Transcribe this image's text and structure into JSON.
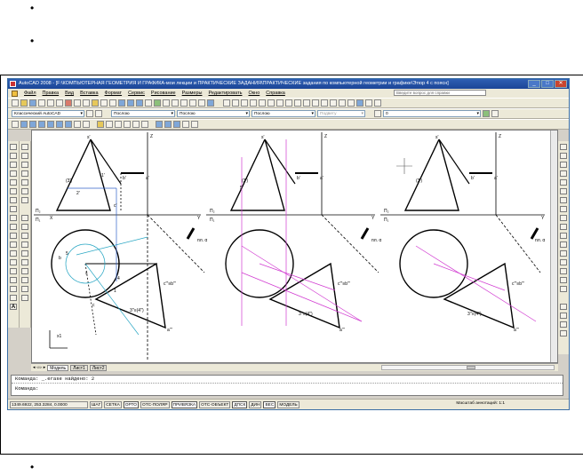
{
  "page": {
    "bullets": [
      "•",
      "•",
      "•"
    ]
  },
  "window": {
    "title": "AutoCAD 2008 - [F:\\КОМПЬЮТЕРНАЯ ГЕОМЕТРИЯ И ГРАФИКА-мои лекции и ПРАКТИЧЕСКИЕ ЗАДАНИЯ\\ПРАКТИЧЕСКИЕ задания по компьютерной геометрии и графике\\Этюр 4 с поясн]",
    "controls": [
      "_",
      "□",
      "✕"
    ]
  },
  "menu": {
    "items": [
      "Файл",
      "Правка",
      "Вид",
      "Вставка",
      "Формат",
      "Сервис",
      "Рисование",
      "Размеры",
      "Редактировать",
      "Окно",
      "Справка"
    ],
    "help_placeholder": "Введите вопрос для справки"
  },
  "toolbar2": {
    "workspace": "Классический AutoCAD",
    "color": "Послою",
    "linetype": "Послою",
    "lineweight": "Послою",
    "plotstyle": "Подвету",
    "layer": "0"
  },
  "drawing": {
    "labels": {
      "s2": "s'",
      "z": "Z",
      "p2": "П₂",
      "p1": "П₁",
      "x": "X",
      "y": "Y",
      "b2": "b'",
      "c2": "c'",
      "a2": "a'",
      "one2": "1'",
      "two2": "2'",
      "three2": "(3')",
      "five2": "5'",
      "pl": "пл. α",
      "c3": "c'''≡b'''",
      "a3": "a'''",
      "s3": "3''≡(4'')",
      "sbig": "s''",
      "x1": "x1",
      "b1": "b",
      "c1": "c",
      "s1": "s",
      "one1": "1",
      "four1": "4",
      "five1": "5"
    }
  },
  "tabs": {
    "items": [
      "Модель",
      "Лист1",
      "Лист2"
    ],
    "nav": "◂ ◃ ▹ ▸"
  },
  "command": {
    "line1": "Команда: _.erase найдено: 2",
    "line2": "Команда:"
  },
  "status": {
    "coords": "1349.6922, 253.3284, 0.0000",
    "buttons": [
      "ШАГ",
      "СЕТКА",
      "ОРТО",
      "ОТС-ПОЛЯР",
      "ПРИВЯЗКА",
      "ОТС-ОБЪЕКТ",
      "ДПСК",
      "ДИН",
      "ВЕС",
      "МОДЕЛЬ"
    ],
    "active": [
      "ОРТО",
      "ПРИВЯЗКА",
      "ДПСК",
      "ВЕС"
    ],
    "scale_label": "Масштаб аннотаций:",
    "scale_value": "1:1"
  },
  "colors": {
    "titlebar": "#1b4597",
    "magenta": "#d13bd1",
    "cyan": "#2aa7c4",
    "blue": "#3060c8"
  }
}
